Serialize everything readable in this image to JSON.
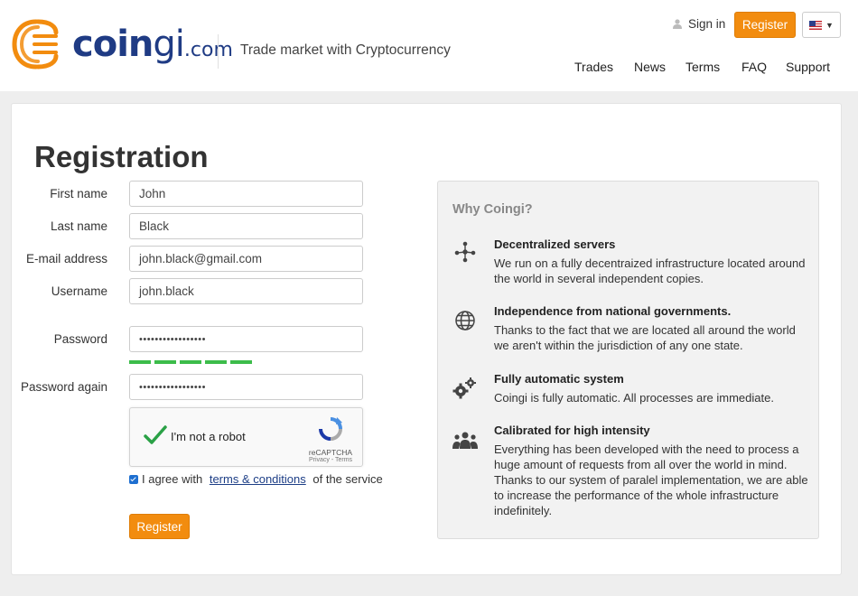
{
  "header": {
    "brand_main": "coin",
    "brand_light": "gi",
    "brand_suffix": ".com",
    "tagline": "Trade market with Cryptocurrency",
    "signin_label": "Sign in",
    "register_label": "Register",
    "language_icon": "us-flag-icon",
    "nav": [
      "Trades",
      "News",
      "Terms",
      "FAQ",
      "Support"
    ]
  },
  "form": {
    "title": "Registration",
    "first_name": {
      "label": "First name",
      "value": "John"
    },
    "last_name": {
      "label": "Last name",
      "value": "Black"
    },
    "email": {
      "label": "E-mail address",
      "value": "john.black@gmail.com"
    },
    "username": {
      "label": "Username",
      "value": "john.black"
    },
    "password": {
      "label": "Password",
      "value": "•••••••••••••••••"
    },
    "password_again": {
      "label": "Password again",
      "value": "•••••••••••••••••"
    },
    "password_strength": 5,
    "captcha_label": "I'm not a robot",
    "captcha_brand": "reCAPTCHA",
    "captcha_links": "Privacy - Terms",
    "agree_prefix": "I agree with ",
    "agree_link": "terms & conditions",
    "agree_suffix": " of the service",
    "submit_label": "Register"
  },
  "why": {
    "title": "Why Coingi?",
    "features": [
      {
        "icon": "network-nodes-icon",
        "title": "Decentralized servers",
        "desc": "We run on a fully decentraized infrastructure located around the world in several independent copies."
      },
      {
        "icon": "globe-icon",
        "title": "Independence from national governments.",
        "desc": "Thanks to the fact that we are located all around the world we aren't within the jurisdiction of any one state."
      },
      {
        "icon": "gears-icon",
        "title": "Fully automatic system",
        "desc": "Coingi is fully automatic. All processes are immediate."
      },
      {
        "icon": "group-icon",
        "title": "Calibrated for high intensity",
        "desc": "Everything has been developed with the need to process a huge amount of requests from all over the world in mind. Thanks to our system of paralel implementation, we are able to increase the performance of the whole infrastructure indefinitely."
      }
    ]
  },
  "colors": {
    "brand_blue": "#1f3b84",
    "accent_orange": "#f28c0f",
    "strength_green": "#3cbc4a"
  }
}
